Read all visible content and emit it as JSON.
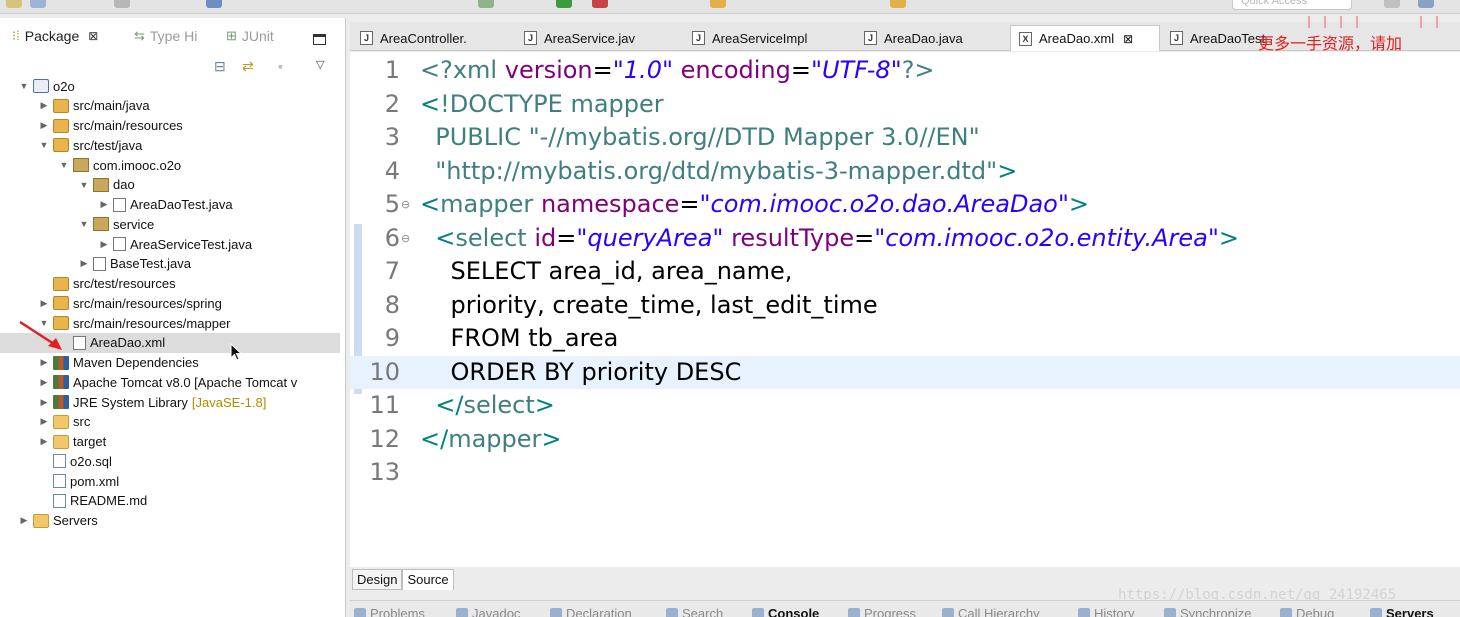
{
  "toolbar": {
    "quick_access_placeholder": "Quick Access"
  },
  "left_view": {
    "tabs": [
      {
        "label": "Package",
        "icon": "package-explorer-icon",
        "active": true
      },
      {
        "label": "Type Hi",
        "icon": "type-hierarchy-icon",
        "active": false
      },
      {
        "label": "JUnit",
        "icon": "junit-icon",
        "active": false
      }
    ],
    "close_glyph": "⊠"
  },
  "tree": [
    {
      "label": "o2o",
      "icon": "project-icon",
      "expanded": true,
      "level": 0
    },
    {
      "label": "src/main/java",
      "icon": "source-folder-icon",
      "expanded": false,
      "level": 1
    },
    {
      "label": "src/main/resources",
      "icon": "source-folder-icon",
      "expanded": false,
      "level": 1
    },
    {
      "label": "src/test/java",
      "icon": "source-folder-icon",
      "expanded": true,
      "level": 1
    },
    {
      "label": "com.imooc.o2o",
      "icon": "package-icon",
      "expanded": true,
      "level": 2
    },
    {
      "label": "dao",
      "icon": "package-icon",
      "expanded": true,
      "level": 3
    },
    {
      "label": "AreaDaoTest.java",
      "icon": "java-file-icon",
      "expanded": false,
      "level": 4
    },
    {
      "label": "service",
      "icon": "package-icon",
      "expanded": true,
      "level": 3
    },
    {
      "label": "AreaServiceTest.java",
      "icon": "java-file-icon",
      "expanded": false,
      "level": 4
    },
    {
      "label": "BaseTest.java",
      "icon": "java-file-icon",
      "expanded": false,
      "level": 3
    },
    {
      "label": "src/test/resources",
      "icon": "source-folder-icon",
      "level": 1
    },
    {
      "label": "src/main/resources/spring",
      "icon": "source-folder-icon",
      "expanded": false,
      "level": 1
    },
    {
      "label": "src/main/resources/mapper",
      "icon": "source-folder-icon",
      "expanded": true,
      "level": 1
    },
    {
      "label": "AreaDao.xml",
      "icon": "xml-file-icon",
      "level": 2,
      "selected": true
    },
    {
      "label": "Maven Dependencies",
      "icon": "library-icon",
      "expanded": false,
      "level": 1
    },
    {
      "label": "Apache Tomcat v8.0 [Apache Tomcat v",
      "icon": "library-icon",
      "expanded": false,
      "level": 1
    },
    {
      "label": "JRE System Library",
      "tag": "[JavaSE-1.8]",
      "icon": "library-icon",
      "expanded": false,
      "level": 1
    },
    {
      "label": "src",
      "icon": "folder-icon",
      "expanded": false,
      "level": 1
    },
    {
      "label": "target",
      "icon": "folder-icon",
      "expanded": false,
      "level": 1
    },
    {
      "label": "o2o.sql",
      "icon": "sql-file-icon",
      "level": 1
    },
    {
      "label": "pom.xml",
      "icon": "maven-pom-icon",
      "level": 1
    },
    {
      "label": "README.md",
      "icon": "markdown-file-icon",
      "level": 1
    },
    {
      "label": "Servers",
      "icon": "folder-icon",
      "expanded": false,
      "level": 0
    }
  ],
  "editor_tabs": [
    {
      "label": "AreaController.",
      "icon": "java-file-icon",
      "active": false
    },
    {
      "label": "AreaService.jav",
      "icon": "java-file-icon",
      "active": false
    },
    {
      "label": "AreaServiceImpl",
      "icon": "java-file-icon",
      "active": false
    },
    {
      "label": "AreaDao.java",
      "icon": "java-file-icon",
      "active": false
    },
    {
      "label": "AreaDao.xml",
      "icon": "xml-file-icon",
      "active": true
    },
    {
      "label": "AreaDaoTest",
      "icon": "java-file-icon",
      "active": false
    }
  ],
  "watermark_cn": "更多一手资源，请加",
  "editor": {
    "current_line": 10,
    "lines": [
      {
        "n": "1",
        "parts": [
          [
            "c-decl",
            "<?xml "
          ],
          [
            "c-attr",
            "version"
          ],
          [
            "c-text",
            "="
          ],
          [
            "c-val",
            "\"1.0\""
          ],
          [
            "c-text",
            " "
          ],
          [
            "c-attr",
            "encoding"
          ],
          [
            "c-text",
            "="
          ],
          [
            "c-val",
            "\"UTF-8\""
          ],
          [
            "c-decl",
            "?>"
          ]
        ]
      },
      {
        "n": "2",
        "parts": [
          [
            "c-bracket",
            "<"
          ],
          [
            "c-decl",
            "!DOCTYPE mapper"
          ]
        ]
      },
      {
        "n": "3",
        "parts": [
          [
            "c-text",
            "  "
          ],
          [
            "c-dtd",
            "PUBLIC "
          ],
          [
            "c-str",
            "\"-//mybatis.org//DTD Mapper 3.0//EN\""
          ]
        ]
      },
      {
        "n": "4",
        "parts": [
          [
            "c-text",
            "  "
          ],
          [
            "c-str",
            "\"http://mybatis.org/dtd/mybatis-3-mapper.dtd\""
          ],
          [
            "c-bracket",
            ">"
          ]
        ]
      },
      {
        "n": "5",
        "fold": true,
        "parts": [
          [
            "c-bracket",
            "<"
          ],
          [
            "c-tag",
            "mapper "
          ],
          [
            "c-attr",
            "namespace"
          ],
          [
            "c-text",
            "="
          ],
          [
            "c-val",
            "\"com.imooc.o2o.dao.AreaDao\""
          ],
          [
            "c-bracket",
            ">"
          ]
        ]
      },
      {
        "n": "6",
        "fold": true,
        "parts": [
          [
            "c-text",
            "  "
          ],
          [
            "c-bracket",
            "<"
          ],
          [
            "c-tag",
            "select "
          ],
          [
            "c-attr",
            "id"
          ],
          [
            "c-text",
            "="
          ],
          [
            "c-val",
            "\"queryArea\""
          ],
          [
            "c-text",
            " "
          ],
          [
            "c-attr",
            "resultType"
          ],
          [
            "c-text",
            "="
          ],
          [
            "c-val",
            "\"com.imooc.o2o.entity.Area\""
          ],
          [
            "c-bracket",
            ">"
          ]
        ]
      },
      {
        "n": "7",
        "parts": [
          [
            "c-text",
            "    SELECT area_id, area_name,"
          ]
        ]
      },
      {
        "n": "8",
        "parts": [
          [
            "c-text",
            "    priority, create_time, last_edit_time"
          ]
        ]
      },
      {
        "n": "9",
        "parts": [
          [
            "c-text",
            "    FROM tb_area"
          ]
        ]
      },
      {
        "n": "10",
        "parts": [
          [
            "c-text",
            "    ORDER BY priority DESC"
          ]
        ]
      },
      {
        "n": "11",
        "parts": [
          [
            "c-text",
            "  "
          ],
          [
            "c-bracket",
            "</"
          ],
          [
            "c-tag",
            "select"
          ],
          [
            "c-bracket",
            ">"
          ]
        ]
      },
      {
        "n": "12",
        "parts": [
          [
            "c-bracket",
            "</"
          ],
          [
            "c-tag",
            "mapper"
          ],
          [
            "c-bracket",
            ">"
          ]
        ]
      },
      {
        "n": "13",
        "parts": []
      }
    ]
  },
  "design_tabs": [
    {
      "label": "Design",
      "active": false
    },
    {
      "label": "Source",
      "active": true
    }
  ],
  "url_watermark": "https://blog.csdn.net/qq_24192465",
  "bottom_tabs": [
    {
      "label": "Problems",
      "bold": false
    },
    {
      "label": "Javadoc",
      "bold": false
    },
    {
      "label": "Declaration",
      "bold": false
    },
    {
      "label": "Search",
      "bold": false
    },
    {
      "label": "Console",
      "bold": true
    },
    {
      "label": "Progress",
      "bold": false
    },
    {
      "label": "Call Hierarchy",
      "bold": false
    },
    {
      "label": "History",
      "bold": false
    },
    {
      "label": "Synchronize",
      "bold": false
    },
    {
      "label": "Debug",
      "bold": false
    },
    {
      "label": "Servers",
      "bold": true
    }
  ]
}
